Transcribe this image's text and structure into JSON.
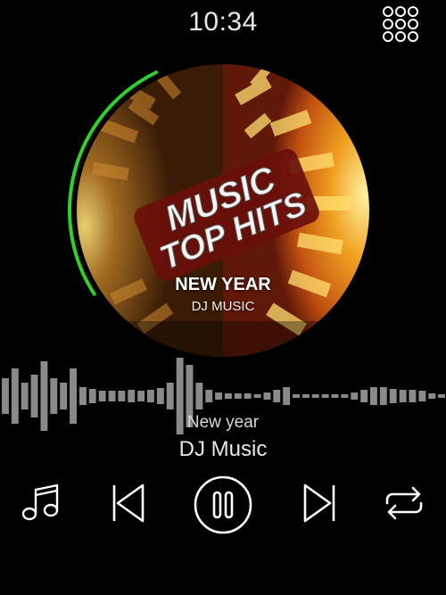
{
  "status_bar": {
    "time": "10:34"
  },
  "album_art": {
    "logo_line1": "MUSIC",
    "logo_line2": "TOP HITS",
    "title": "NEW YEAR",
    "subtitle": "DJ MUSIC"
  },
  "now_playing": {
    "title": "New year",
    "artist": "DJ Music",
    "progress": 0.27
  },
  "controls": {
    "library_icon": "music-note-icon",
    "previous_icon": "skip-previous-icon",
    "play_pause_icon": "pause-icon",
    "next_icon": "skip-next-icon",
    "repeat_icon": "repeat-icon",
    "apps_icon": "apps-grid-icon"
  },
  "colors": {
    "background": "#000000",
    "progress_ring": "#2fd12f",
    "waveform": "#8a8a8a",
    "icon": "#ffffff"
  }
}
